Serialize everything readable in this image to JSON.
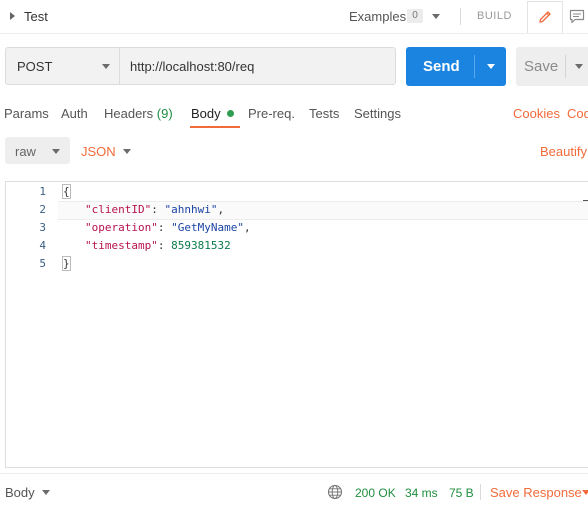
{
  "tab": {
    "title": "Test"
  },
  "examples": {
    "label": "Examples",
    "count": "0"
  },
  "build_label": "BUILD",
  "request": {
    "method": "POST",
    "url": "http://localhost:80/req"
  },
  "buttons": {
    "send": "Send",
    "save": "Save"
  },
  "tabs": [
    {
      "label": "Params"
    },
    {
      "label": "Auth"
    },
    {
      "label": "Headers",
      "count": "(9)"
    },
    {
      "label": "Body"
    },
    {
      "label": "Pre-req."
    },
    {
      "label": "Tests"
    },
    {
      "label": "Settings"
    }
  ],
  "links": {
    "cookies": "Cookies",
    "code": "Code"
  },
  "body_options": {
    "mode": "raw",
    "format": "JSON",
    "beautify": "Beautify"
  },
  "editor": {
    "line_numbers": [
      "1",
      "2",
      "3",
      "4",
      "5"
    ],
    "open_brace": "{",
    "close_brace": "}",
    "fields": [
      {
        "key": "\"clientID\"",
        "value": "\"ahnhwi\"",
        "trail": ","
      },
      {
        "key": "\"operation\"",
        "value": "\"GetMyName\"",
        "trail": ","
      },
      {
        "key": "\"timestamp\"",
        "value": "859381532",
        "trail": ""
      }
    ]
  },
  "response": {
    "tab": "Body",
    "status": "200 OK",
    "time": "34 ms",
    "size": "75 B",
    "save": "Save Response"
  },
  "colors": {
    "accent": "#f26b3a",
    "send": "#1a84e0",
    "ok": "#1e8e3e"
  },
  "icons": [
    "chevron-right-icon",
    "pencil-icon",
    "comment-icon",
    "globe-icon"
  ]
}
